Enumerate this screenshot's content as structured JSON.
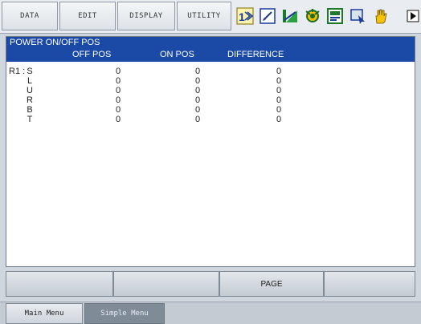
{
  "menu": {
    "items": [
      "DATA",
      "EDIT",
      "DISPLAY",
      "UTILITY"
    ]
  },
  "status_icons": [
    "speed-icon",
    "edit-mode-icon",
    "chart-icon",
    "gear-icon",
    "program-icon",
    "cursor-icon",
    "hand-icon",
    "arrow-right-icon"
  ],
  "panel": {
    "title": "POWER ON/OFF POS",
    "columns": {
      "off": "OFF POS",
      "on": "ON POS",
      "diff": "DIFFERENCE"
    },
    "robot": "R1 :",
    "rows": [
      {
        "axis": "S",
        "off": "0",
        "on": "0",
        "diff": "0"
      },
      {
        "axis": "L",
        "off": "0",
        "on": "0",
        "diff": "0"
      },
      {
        "axis": "U",
        "off": "0",
        "on": "0",
        "diff": "0"
      },
      {
        "axis": "R",
        "off": "0",
        "on": "0",
        "diff": "0"
      },
      {
        "axis": "B",
        "off": "0",
        "on": "0",
        "diff": "0"
      },
      {
        "axis": "T",
        "off": "0",
        "on": "0",
        "diff": "0"
      }
    ]
  },
  "fkeys": [
    "",
    "",
    "PAGE",
    ""
  ],
  "tabs": {
    "main": "Main Menu",
    "simple": "Simple Menu"
  },
  "colors": {
    "title_bar": "#1a4aa6",
    "background": "#cfd6de"
  }
}
